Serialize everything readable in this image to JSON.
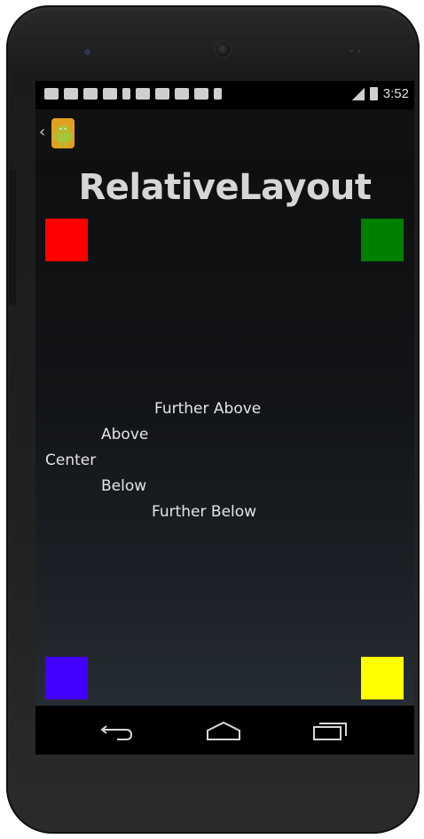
{
  "status_bar": {
    "time": "3:52",
    "notification_icons": [
      "message-icon",
      "mail-icon",
      "download-icon",
      "chat-icon",
      "notification-icon",
      "facebook-icon",
      "person-icon",
      "media-icon",
      "clipboard-icon",
      "notification-icon"
    ]
  },
  "action_bar": {
    "app_icon": "android-robot-icon"
  },
  "main": {
    "title": "RelativeLayout",
    "squares": [
      {
        "name": "top-left",
        "color": "#ff0000"
      },
      {
        "name": "top-right",
        "color": "#008000"
      },
      {
        "name": "bottom-left",
        "color": "#4400ff"
      },
      {
        "name": "bottom-right",
        "color": "#ffff00"
      }
    ],
    "labels": {
      "further_above": "Further Above",
      "above": "Above",
      "center": "Center",
      "below": "Below",
      "further_below": "Further Below"
    }
  },
  "nav_bar": {
    "buttons": [
      "back-icon",
      "home-icon",
      "recents-icon"
    ]
  }
}
